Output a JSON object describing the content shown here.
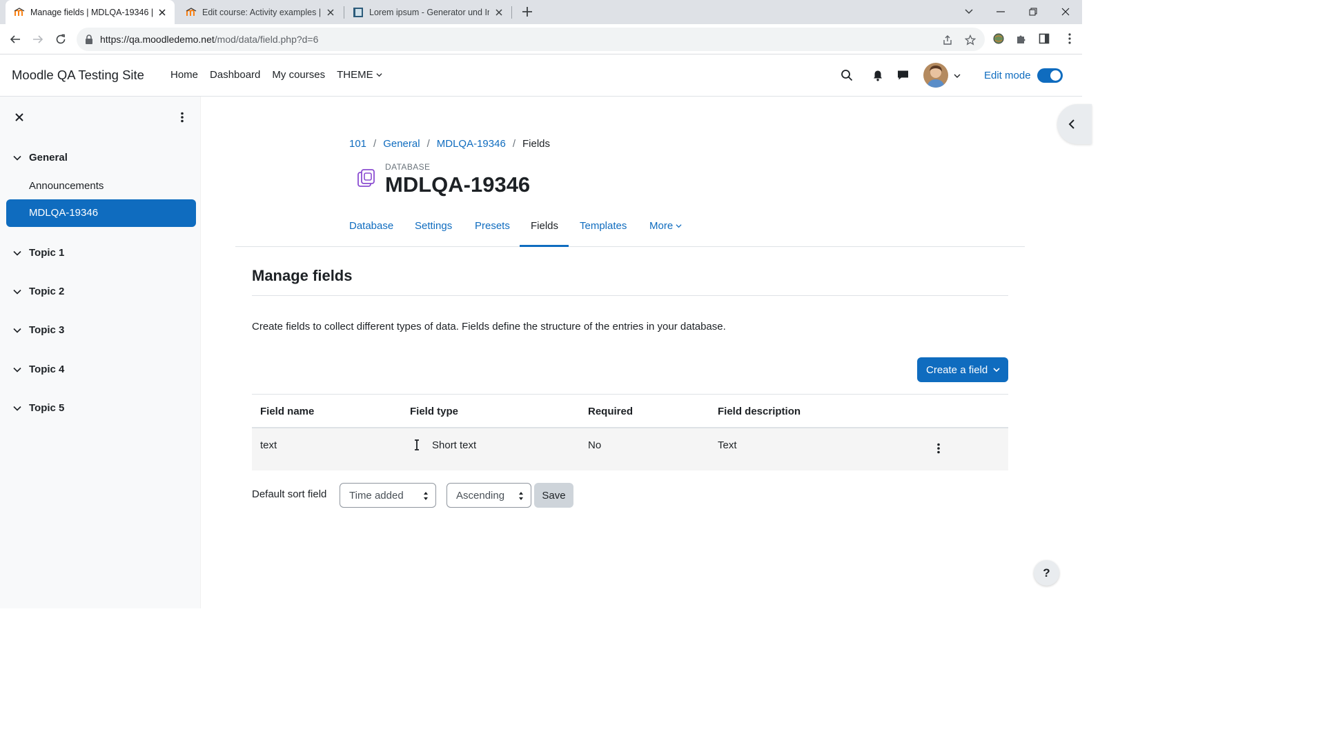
{
  "browser": {
    "tabs": [
      {
        "title": "Manage fields | MDLQA-19346 | M",
        "favicon": "moodle-icon",
        "active": true
      },
      {
        "title": "Edit course: Activity examples | M",
        "favicon": "moodle-icon",
        "active": false
      },
      {
        "title": "Lorem ipsum - Generator und Info",
        "favicon": "document-icon",
        "active": false
      }
    ],
    "url_host": "https://qa.moodledemo.net",
    "url_path": "/mod/data/field.php?d=6"
  },
  "navbar": {
    "site_name": "Moodle QA Testing Site",
    "items": [
      "Home",
      "Dashboard",
      "My courses",
      "THEME"
    ],
    "edit_mode_label": "Edit mode",
    "edit_mode_on": true
  },
  "course_index": {
    "sections": [
      {
        "name": "General",
        "activities": [
          "Announcements",
          "MDLQA-19346"
        ],
        "active_activity": "MDLQA-19346"
      },
      {
        "name": "Topic 1"
      },
      {
        "name": "Topic 2"
      },
      {
        "name": "Topic 3"
      },
      {
        "name": "Topic 4"
      },
      {
        "name": "Topic 5"
      }
    ]
  },
  "breadcrumb": [
    "101",
    "General",
    "MDLQA-19346",
    "Fields"
  ],
  "header": {
    "module_type": "DATABASE",
    "title": "MDLQA-19346"
  },
  "secondary_nav": {
    "items": [
      "Database",
      "Settings",
      "Presets",
      "Fields",
      "Templates",
      "More"
    ],
    "active": "Fields"
  },
  "main": {
    "heading": "Manage fields",
    "intro": "Create fields to collect different types of data. Fields define the structure of the entries in your database.",
    "create_button": "Create a field"
  },
  "fields_table": {
    "columns": [
      "Field name",
      "Field type",
      "Required",
      "Field description"
    ],
    "rows": [
      {
        "name": "text",
        "type": "Short text",
        "type_icon": "text-cursor-icon",
        "required": "No",
        "description": "Text"
      }
    ]
  },
  "sort": {
    "label": "Default sort field",
    "field_value": "Time added",
    "order_value": "Ascending",
    "save_label": "Save"
  },
  "help_label": "?",
  "colors": {
    "primary": "#0f6cbf",
    "text": "#1d2125",
    "drawer_bg": "#f8f9fa",
    "row_bg": "#f5f5f5",
    "module_icon": "#8a4cd1"
  }
}
